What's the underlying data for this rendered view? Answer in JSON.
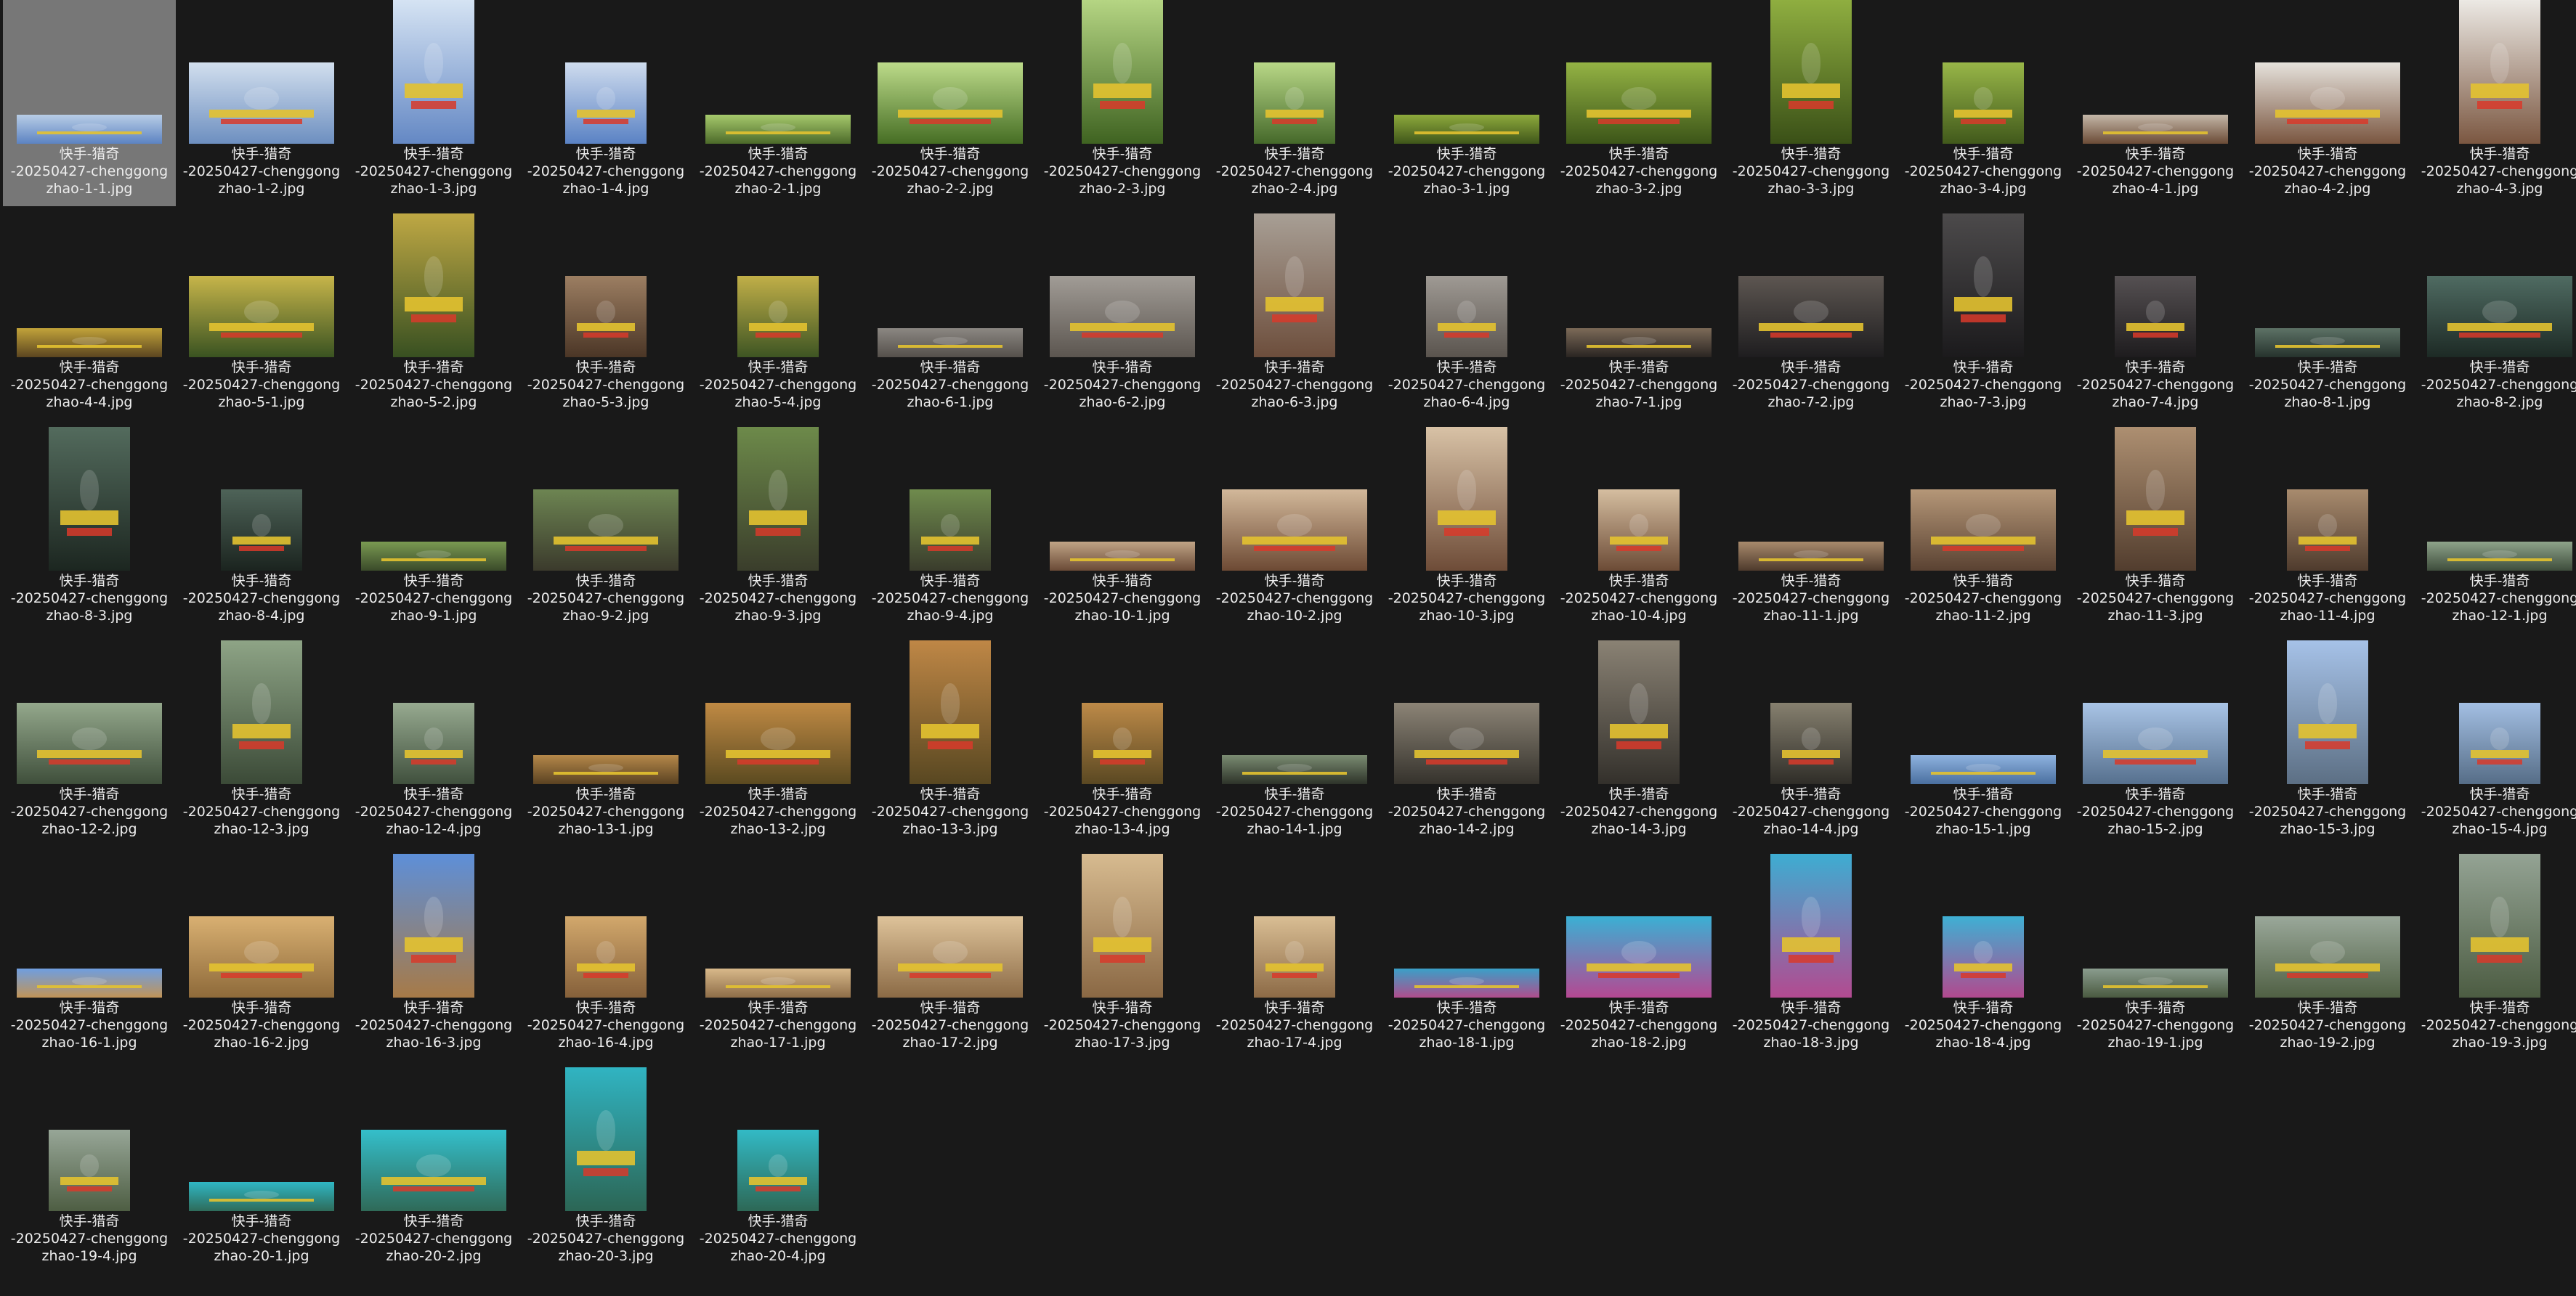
{
  "explorer": {
    "selected_index": 0,
    "name_prefix": "快手-猎奇",
    "name_middle": "-20250427-chenggong",
    "items": [
      {
        "line3": "zhao-1-1.jpg",
        "shape": "strip",
        "colors": [
          "#b8cde6",
          "#5c83c2"
        ]
      },
      {
        "line3": "zhao-1-2.jpg",
        "shape": "wide",
        "colors": [
          "#d2dfee",
          "#6d8fc0"
        ]
      },
      {
        "line3": "zhao-1-3.jpg",
        "shape": "tall",
        "colors": [
          "#d5e3f3",
          "#6488c4"
        ]
      },
      {
        "line3": "zhao-1-4.jpg",
        "shape": "square",
        "colors": [
          "#cfdcee",
          "#5a82c4"
        ]
      },
      {
        "line3": "zhao-2-1.jpg",
        "shape": "strip",
        "colors": [
          "#a6c96c",
          "#4c6a2a"
        ]
      },
      {
        "line3": "zhao-2-2.jpg",
        "shape": "wide",
        "colors": [
          "#bddb8a",
          "#466e24"
        ]
      },
      {
        "line3": "zhao-2-3.jpg",
        "shape": "tall",
        "colors": [
          "#b5d583",
          "#3f6321"
        ]
      },
      {
        "line3": "zhao-2-4.jpg",
        "shape": "square",
        "colors": [
          "#b9d887",
          "#45692a"
        ]
      },
      {
        "line3": "zhao-3-1.jpg",
        "shape": "strip",
        "colors": [
          "#8eaa3c",
          "#3f561a"
        ]
      },
      {
        "line3": "zhao-3-2.jpg",
        "shape": "wide",
        "colors": [
          "#94b344",
          "#3c5518"
        ]
      },
      {
        "line3": "zhao-3-3.jpg",
        "shape": "tall",
        "colors": [
          "#8fae40",
          "#3a5017"
        ]
      },
      {
        "line3": "zhao-3-4.jpg",
        "shape": "square",
        "colors": [
          "#98b648",
          "#41591b"
        ]
      },
      {
        "line3": "zhao-4-1.jpg",
        "shape": "strip",
        "colors": [
          "#c4b7a8",
          "#6b4b36"
        ]
      },
      {
        "line3": "zhao-4-2.jpg",
        "shape": "wide",
        "colors": [
          "#e6e2dc",
          "#7a5640"
        ]
      },
      {
        "line3": "zhao-4-3.jpg",
        "shape": "tall",
        "colors": [
          "#ece9e4",
          "#7b5741"
        ]
      },
      {
        "line3": "zhao-4-4.jpg",
        "shape": "strip",
        "colors": [
          "#c2a33a",
          "#5b4520"
        ]
      },
      {
        "line3": "zhao-5-1.jpg",
        "shape": "wide",
        "colors": [
          "#c7b54a",
          "#3a5321"
        ]
      },
      {
        "line3": "zhao-5-2.jpg",
        "shape": "tall",
        "colors": [
          "#bfa844",
          "#385021"
        ]
      },
      {
        "line3": "zhao-5-3.jpg",
        "shape": "square",
        "colors": [
          "#9c7e62",
          "#4b3626"
        ]
      },
      {
        "line3": "zhao-5-4.jpg",
        "shape": "square",
        "colors": [
          "#c1af48",
          "#3e5523"
        ]
      },
      {
        "line3": "zhao-6-1.jpg",
        "shape": "strip",
        "colors": [
          "#8b8782",
          "#55504b"
        ]
      },
      {
        "line3": "zhao-6-2.jpg",
        "shape": "wide",
        "colors": [
          "#a19c96",
          "#5c5650"
        ]
      },
      {
        "line3": "zhao-6-3.jpg",
        "shape": "tall",
        "colors": [
          "#a89f95",
          "#6d4e3c"
        ]
      },
      {
        "line3": "zhao-6-4.jpg",
        "shape": "square",
        "colors": [
          "#9f9a94",
          "#5a544e"
        ]
      },
      {
        "line3": "zhao-7-1.jpg",
        "shape": "strip",
        "colors": [
          "#7c6a58",
          "#2a2522"
        ]
      },
      {
        "line3": "zhao-7-2.jpg",
        "shape": "wide",
        "colors": [
          "#5d5651",
          "#1e1d1f"
        ]
      },
      {
        "line3": "zhao-7-3.jpg",
        "shape": "tall",
        "colors": [
          "#4c4a4b",
          "#1b1a1c"
        ]
      },
      {
        "line3": "zhao-7-4.jpg",
        "shape": "square",
        "colors": [
          "#555052",
          "#1e1c1e"
        ]
      },
      {
        "line3": "zhao-8-1.jpg",
        "shape": "strip",
        "colors": [
          "#5d7266",
          "#26332d"
        ]
      },
      {
        "line3": "zhao-8-2.jpg",
        "shape": "wide",
        "colors": [
          "#4f6b62",
          "#1d2a25"
        ]
      },
      {
        "line3": "zhao-8-3.jpg",
        "shape": "tall",
        "colors": [
          "#536b5d",
          "#1c2620"
        ]
      },
      {
        "line3": "zhao-8-4.jpg",
        "shape": "square",
        "colors": [
          "#4e6358",
          "#1b241f"
        ]
      },
      {
        "line3": "zhao-9-1.jpg",
        "shape": "strip",
        "colors": [
          "#7a9a52",
          "#3a4a2a"
        ]
      },
      {
        "line3": "zhao-9-2.jpg",
        "shape": "wide",
        "colors": [
          "#6d8552",
          "#3b3a2c"
        ]
      },
      {
        "line3": "zhao-9-3.jpg",
        "shape": "tall",
        "colors": [
          "#6d8a4a",
          "#3a3d2b"
        ]
      },
      {
        "line3": "zhao-9-4.jpg",
        "shape": "square",
        "colors": [
          "#6f8b4d",
          "#3a3c2c"
        ]
      },
      {
        "line3": "zhao-10-1.jpg",
        "shape": "strip",
        "colors": [
          "#c0a486",
          "#6a4a36"
        ]
      },
      {
        "line3": "zhao-10-2.jpg",
        "shape": "wide",
        "colors": [
          "#d2b89a",
          "#6d4a34"
        ]
      },
      {
        "line3": "zhao-10-3.jpg",
        "shape": "tall",
        "colors": [
          "#d8c2a6",
          "#6e4c38"
        ]
      },
      {
        "line3": "zhao-10-4.jpg",
        "shape": "square",
        "colors": [
          "#d5bea0",
          "#6c4b36"
        ]
      },
      {
        "line3": "zhao-11-1.jpg",
        "shape": "strip",
        "colors": [
          "#a88a6c",
          "#4e3a2c"
        ]
      },
      {
        "line3": "zhao-11-2.jpg",
        "shape": "wide",
        "colors": [
          "#b59778",
          "#5a4232"
        ]
      },
      {
        "line3": "zhao-11-3.jpg",
        "shape": "tall",
        "colors": [
          "#ad8f71",
          "#523d2e"
        ]
      },
      {
        "line3": "zhao-11-4.jpg",
        "shape": "square",
        "colors": [
          "#a88b6e",
          "#4f3b2d"
        ]
      },
      {
        "line3": "zhao-12-1.jpg",
        "shape": "strip",
        "colors": [
          "#8ea38a",
          "#3e4d3c"
        ]
      },
      {
        "line3": "zhao-12-2.jpg",
        "shape": "wide",
        "colors": [
          "#94a88c",
          "#3f4f3b"
        ]
      },
      {
        "line3": "zhao-12-3.jpg",
        "shape": "tall",
        "colors": [
          "#8ea486",
          "#3b4a37"
        ]
      },
      {
        "line3": "zhao-12-4.jpg",
        "shape": "square",
        "colors": [
          "#97aa90",
          "#40503d"
        ]
      },
      {
        "line3": "zhao-13-1.jpg",
        "shape": "strip",
        "colors": [
          "#b5884a",
          "#5a4222"
        ]
      },
      {
        "line3": "zhao-13-2.jpg",
        "shape": "wide",
        "colors": [
          "#c08a44",
          "#5b4a20"
        ]
      },
      {
        "line3": "zhao-13-3.jpg",
        "shape": "tall",
        "colors": [
          "#bf8746",
          "#584721"
        ]
      },
      {
        "line3": "zhao-13-4.jpg",
        "shape": "square",
        "colors": [
          "#bd8a48",
          "#5a4822"
        ]
      },
      {
        "line3": "zhao-14-1.jpg",
        "shape": "strip",
        "colors": [
          "#7b8c72",
          "#2d3329"
        ]
      },
      {
        "line3": "zhao-14-2.jpg",
        "shape": "wide",
        "colors": [
          "#8c8476",
          "#35322c"
        ]
      },
      {
        "line3": "zhao-14-3.jpg",
        "shape": "tall",
        "colors": [
          "#8a8274",
          "#33302b"
        ]
      },
      {
        "line3": "zhao-14-4.jpg",
        "shape": "square",
        "colors": [
          "#86806f",
          "#2f2d28"
        ]
      },
      {
        "line3": "zhao-15-1.jpg",
        "shape": "strip",
        "colors": [
          "#8fb3e0",
          "#4a6f9f"
        ]
      },
      {
        "line3": "zhao-15-2.jpg",
        "shape": "wide",
        "colors": [
          "#a9c4e6",
          "#56708e"
        ]
      },
      {
        "line3": "zhao-15-3.jpg",
        "shape": "tall",
        "colors": [
          "#a6c2e8",
          "#5c6f84"
        ]
      },
      {
        "line3": "zhao-15-4.jpg",
        "shape": "square",
        "colors": [
          "#a3bfe3",
          "#566d87"
        ]
      },
      {
        "line3": "zhao-16-1.jpg",
        "shape": "strip",
        "colors": [
          "#6f9ee0",
          "#c19457"
        ]
      },
      {
        "line3": "zhao-16-2.jpg",
        "shape": "wide",
        "colors": [
          "#d9b072",
          "#8e6a3a"
        ]
      },
      {
        "line3": "zhao-16-3.jpg",
        "shape": "tall",
        "colors": [
          "#5d8fd9",
          "#a77a47"
        ]
      },
      {
        "line3": "zhao-16-4.jpg",
        "shape": "square",
        "colors": [
          "#d2a86c",
          "#85603a"
        ]
      },
      {
        "line3": "zhao-17-1.jpg",
        "shape": "strip",
        "colors": [
          "#d8b98a",
          "#8e6d48"
        ]
      },
      {
        "line3": "zhao-17-2.jpg",
        "shape": "wide",
        "colors": [
          "#dec39a",
          "#8b6a45"
        ]
      },
      {
        "line3": "zhao-17-3.jpg",
        "shape": "tall",
        "colors": [
          "#d7bb90",
          "#8a6844"
        ]
      },
      {
        "line3": "zhao-17-4.jpg",
        "shape": "square",
        "colors": [
          "#d9be94",
          "#8c6a46"
        ]
      },
      {
        "line3": "zhao-18-1.jpg",
        "shape": "strip",
        "colors": [
          "#3aa0c8",
          "#b04d8c"
        ]
      },
      {
        "line3": "zhao-18-2.jpg",
        "shape": "wide",
        "colors": [
          "#3ab0d4",
          "#b54892"
        ]
      },
      {
        "line3": "zhao-18-3.jpg",
        "shape": "tall",
        "colors": [
          "#3dadd2",
          "#b34a90"
        ]
      },
      {
        "line3": "zhao-18-4.jpg",
        "shape": "square",
        "colors": [
          "#3eb0d4",
          "#b2498e"
        ]
      },
      {
        "line3": "zhao-19-1.jpg",
        "shape": "strip",
        "colors": [
          "#8a9c8e",
          "#4a5a40"
        ]
      },
      {
        "line3": "zhao-19-2.jpg",
        "shape": "wide",
        "colors": [
          "#9aa89a",
          "#506044"
        ]
      },
      {
        "line3": "zhao-19-3.jpg",
        "shape": "tall",
        "colors": [
          "#94a394",
          "#4c5c42"
        ]
      },
      {
        "line3": "zhao-19-4.jpg",
        "shape": "square",
        "colors": [
          "#97a697",
          "#4e5e43"
        ]
      },
      {
        "line3": "zhao-20-1.jpg",
        "shape": "strip",
        "colors": [
          "#2fb7c4",
          "#2e6b5a"
        ]
      },
      {
        "line3": "zhao-20-2.jpg",
        "shape": "wide",
        "colors": [
          "#34bfcb",
          "#2f6a58"
        ]
      },
      {
        "line3": "zhao-20-3.jpg",
        "shape": "tall",
        "colors": [
          "#30b4c2",
          "#2c6655"
        ]
      },
      {
        "line3": "zhao-20-4.jpg",
        "shape": "square",
        "colors": [
          "#32bac6",
          "#2d6856"
        ]
      }
    ]
  }
}
